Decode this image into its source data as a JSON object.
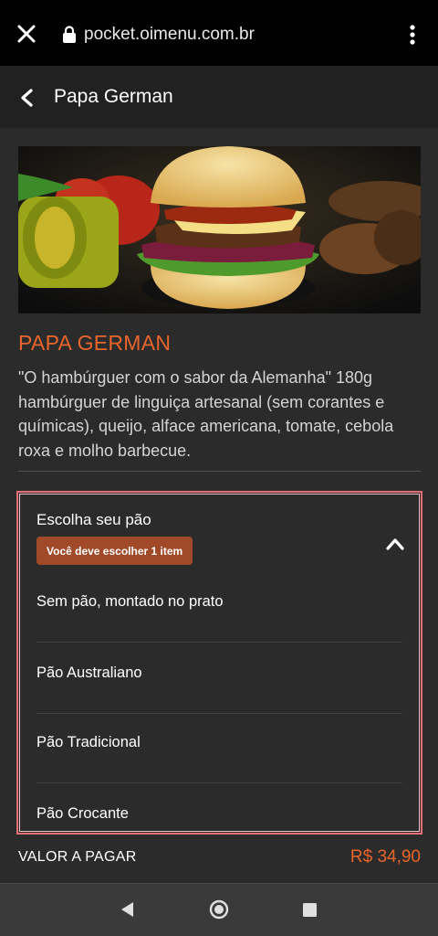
{
  "browser": {
    "url": "pocket.oimenu.com.br",
    "icons": [
      "close-icon",
      "lock-icon",
      "more-vert-icon"
    ]
  },
  "header": {
    "title": "Papa German",
    "back_icon": "chevron-left-icon"
  },
  "product": {
    "name": "PAPA GERMAN",
    "description": "\"O hambúrguer com o sabor da Alemanha\" 180g hambúrguer de linguiça artesanal (sem corantes e químicas), queijo, alface americana, tomate, cebola roxa e molho barbecue."
  },
  "options_group": {
    "title": "Escolha seu pão",
    "required_badge": "Você deve escolher 1 item",
    "collapse_icon": "chevron-up-icon",
    "items": [
      {
        "label": "Sem pão, montado no prato"
      },
      {
        "label": "Pão Australiano"
      },
      {
        "label": "Pão Tradicional"
      },
      {
        "label": "Pão Crocante"
      }
    ]
  },
  "total": {
    "label": "VALOR A PAGAR",
    "price": "R$ 34,90"
  },
  "system_nav": {
    "icons": [
      "back-triangle-icon",
      "home-circle-icon",
      "recents-square-icon"
    ]
  },
  "colors": {
    "accent": "#e8652b",
    "badge": "#a14a29",
    "highlight_border": "#e56e77",
    "background": "#2b2b2b"
  }
}
